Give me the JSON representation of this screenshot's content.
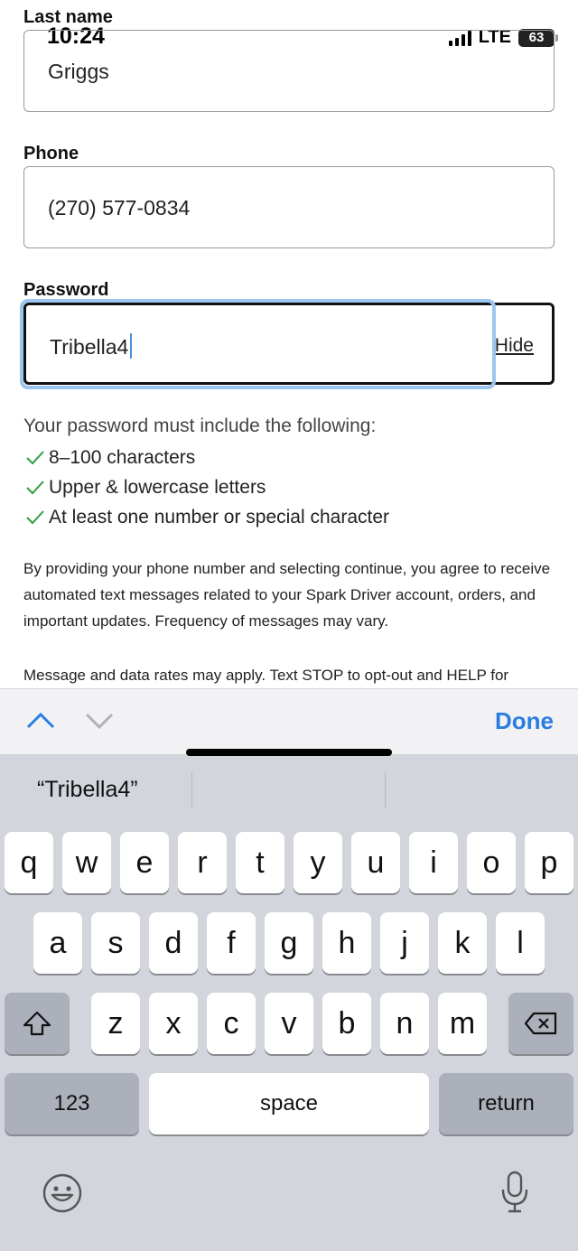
{
  "status_bar": {
    "time": "10:24",
    "network": "LTE",
    "battery": "63"
  },
  "form": {
    "last_name_label": "Last name",
    "last_name_value": "Griggs",
    "phone_label": "Phone",
    "phone_value": "(270) 577-0834",
    "password_label": "Password",
    "password_value": "Tribella4",
    "hide_label": "Hide"
  },
  "requirements": {
    "title": "Your password must include the following:",
    "items": [
      "8–100 characters",
      "Upper & lowercase letters",
      "At least one number or special character"
    ],
    "check_color": "#2e9e3f"
  },
  "disclaimer": {
    "p1": "By providing your phone number and selecting continue, you agree to receive automated text messages related to your Spark Driver account, orders, and important updates. Frequency of messages may vary.",
    "p2": "Message and data rates may apply. Text STOP to opt-out and HELP for"
  },
  "accessory_bar": {
    "done_label": "Done",
    "prev_icon": "chevron-up-icon",
    "next_icon": "chevron-down-icon",
    "accent": "#2a7de1"
  },
  "keyboard": {
    "suggestion": "“Tribella4”",
    "row1": [
      "q",
      "w",
      "e",
      "r",
      "t",
      "y",
      "u",
      "i",
      "o",
      "p"
    ],
    "row2": [
      "a",
      "s",
      "d",
      "f",
      "g",
      "h",
      "j",
      "k",
      "l"
    ],
    "row3": [
      "z",
      "x",
      "c",
      "v",
      "b",
      "n",
      "m"
    ],
    "numbers_label": "123",
    "space_label": "space",
    "return_label": "return",
    "shift_icon": "shift-icon",
    "delete_icon": "delete-icon",
    "emoji_icon": "emoji-icon",
    "mic_icon": "microphone-icon"
  }
}
